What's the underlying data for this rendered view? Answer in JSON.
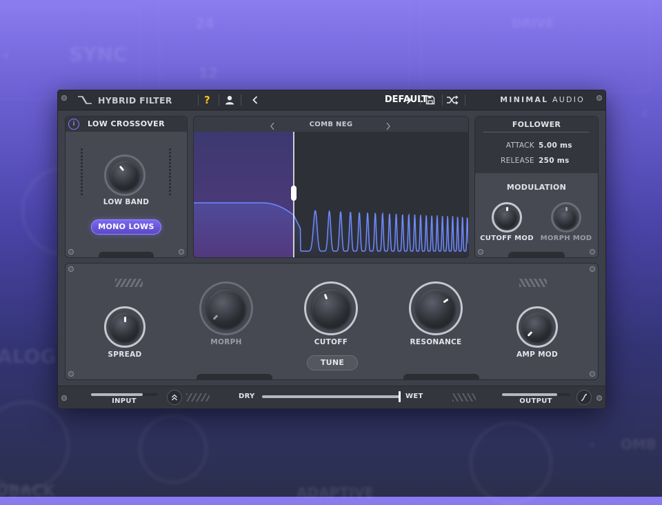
{
  "background": {
    "labels": [
      "SYNC",
      "DRIVE",
      "24",
      "12",
      "ALOG",
      "OMB",
      "DBACK",
      "ADAPTIVE"
    ]
  },
  "topbar": {
    "title": "HYBRID FILTER",
    "help": "?",
    "preset": "DEFAULT",
    "brand_bold": "MINIMAL",
    "brand_light": "AUDIO"
  },
  "crossover": {
    "title": "LOW CROSSOVER",
    "info": "i",
    "knob_label": "LOW BAND",
    "mono_button": "MONO LOWS"
  },
  "display": {
    "mode": "COMB NEG"
  },
  "follower": {
    "title": "FOLLOWER",
    "attack_label": "ATTACK",
    "attack_value": "5.00 ms",
    "release_label": "RELEASE",
    "release_value": "250 ms"
  },
  "modulation": {
    "title": "MODULATION",
    "cutoff_mod": "CUTOFF MOD",
    "morph_mod": "MORPH MOD"
  },
  "main": {
    "spread": "SPREAD",
    "morph": "MORPH",
    "cutoff": "CUTOFF",
    "resonance": "RESONANCE",
    "amp_mod": "AMP MOD",
    "tune": "TUNE"
  },
  "bottom": {
    "input": "INPUT",
    "dry": "DRY",
    "wet": "WET",
    "output": "OUTPUT",
    "input_level": 0.78,
    "mix": 0.99,
    "output_level": 0.82
  },
  "colors": {
    "accent": "#7b68ee",
    "curve": "#6f8bff",
    "warning": "#f5c518"
  }
}
